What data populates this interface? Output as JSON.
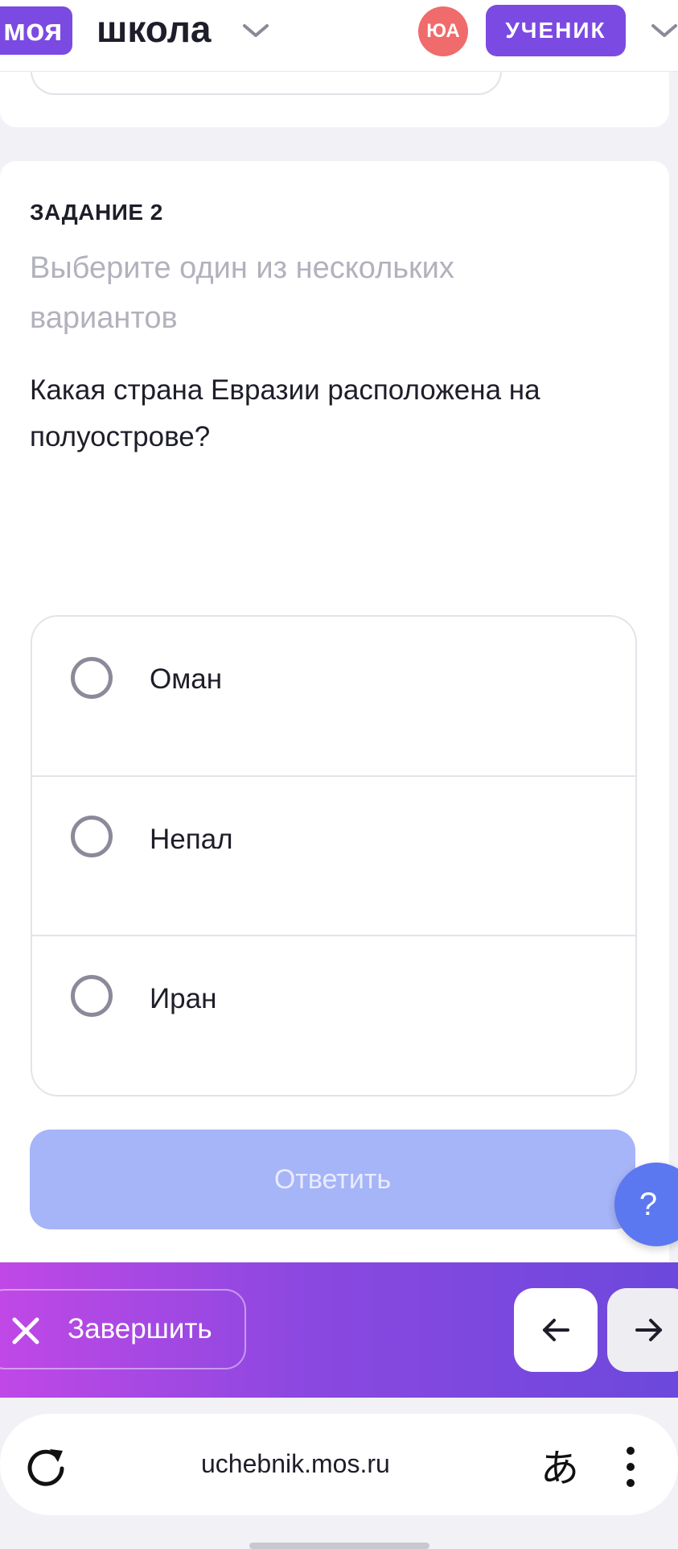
{
  "header": {
    "logo_moya": "моя",
    "logo_shkola": "школа",
    "avatar_initials": "ЮА",
    "role_label": "УЧЕНИК"
  },
  "task": {
    "label": "ЗАДАНИЕ 2",
    "hint": "Выберите один из нескольких вариантов",
    "question": "Какая страна Евразии расположена на полуострове?",
    "options": [
      {
        "label": "Оман"
      },
      {
        "label": "Непал"
      },
      {
        "label": "Иран"
      }
    ],
    "answer_label": "Ответить",
    "help_label": "?"
  },
  "bottom_bar": {
    "finish_label": "Завершить"
  },
  "browser": {
    "url": "uchebnik.mos.ru",
    "translate_glyph": "あ"
  },
  "colors": {
    "accent": "#7b4ae2",
    "answer_disabled": "#a6b4f8",
    "help": "#5b78f0",
    "avatar": "#f06b6b"
  }
}
